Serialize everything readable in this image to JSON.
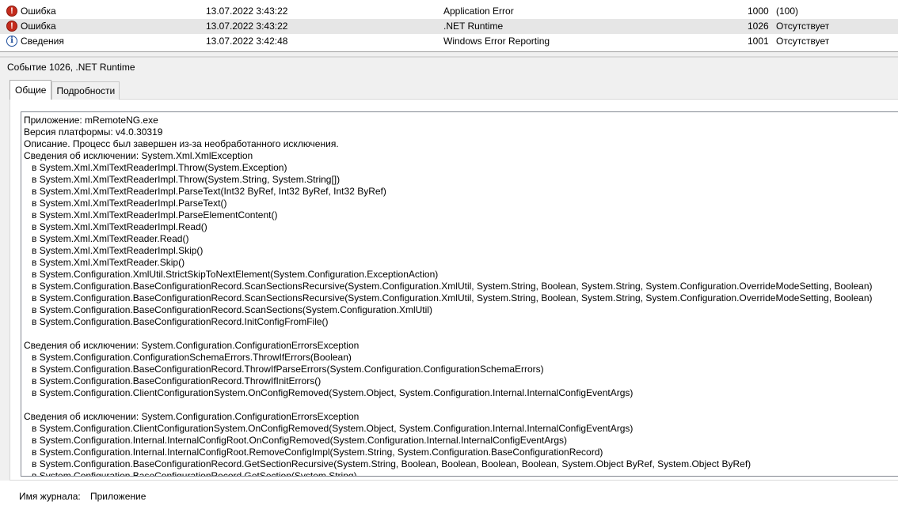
{
  "event_list": {
    "rows": [
      {
        "level": "Ошибка",
        "level_icon": "error-icon",
        "date": "13.07.2022 3:43:22",
        "source": "Application Error",
        "event_id": "1000",
        "category": "(100)",
        "selected": false
      },
      {
        "level": "Ошибка",
        "level_icon": "error-icon",
        "date": "13.07.2022 3:43:22",
        "source": ".NET Runtime",
        "event_id": "1026",
        "category": "Отсутствует",
        "selected": true
      },
      {
        "level": "Сведения",
        "level_icon": "info-icon",
        "date": "13.07.2022 3:42:48",
        "source": "Windows Error Reporting",
        "event_id": "1001",
        "category": "Отсутствует",
        "selected": false
      }
    ]
  },
  "details": {
    "title": "Событие 1026, .NET Runtime",
    "tabs": [
      {
        "label": "Общие",
        "active": true
      },
      {
        "label": "Подробности",
        "active": false
      }
    ],
    "description_lines": [
      "Приложение: mRemoteNG.exe",
      "Версия платформы: v4.0.30319",
      "Описание. Процесс был завершен из-за необработанного исключения.",
      "Сведения об исключении: System.Xml.XmlException",
      "   в System.Xml.XmlTextReaderImpl.Throw(System.Exception)",
      "   в System.Xml.XmlTextReaderImpl.Throw(System.String, System.String[])",
      "   в System.Xml.XmlTextReaderImpl.ParseText(Int32 ByRef, Int32 ByRef, Int32 ByRef)",
      "   в System.Xml.XmlTextReaderImpl.ParseText()",
      "   в System.Xml.XmlTextReaderImpl.ParseElementContent()",
      "   в System.Xml.XmlTextReaderImpl.Read()",
      "   в System.Xml.XmlTextReader.Read()",
      "   в System.Xml.XmlTextReaderImpl.Skip()",
      "   в System.Xml.XmlTextReader.Skip()",
      "   в System.Configuration.XmlUtil.StrictSkipToNextElement(System.Configuration.ExceptionAction)",
      "   в System.Configuration.BaseConfigurationRecord.ScanSectionsRecursive(System.Configuration.XmlUtil, System.String, Boolean, System.String, System.Configuration.OverrideModeSetting, Boolean)",
      "   в System.Configuration.BaseConfigurationRecord.ScanSectionsRecursive(System.Configuration.XmlUtil, System.String, Boolean, System.String, System.Configuration.OverrideModeSetting, Boolean)",
      "   в System.Configuration.BaseConfigurationRecord.ScanSections(System.Configuration.XmlUtil)",
      "   в System.Configuration.BaseConfigurationRecord.InitConfigFromFile()",
      "",
      "Сведения об исключении: System.Configuration.ConfigurationErrorsException",
      "   в System.Configuration.ConfigurationSchemaErrors.ThrowIfErrors(Boolean)",
      "   в System.Configuration.BaseConfigurationRecord.ThrowIfParseErrors(System.Configuration.ConfigurationSchemaErrors)",
      "   в System.Configuration.BaseConfigurationRecord.ThrowIfInitErrors()",
      "   в System.Configuration.ClientConfigurationSystem.OnConfigRemoved(System.Object, System.Configuration.Internal.InternalConfigEventArgs)",
      "",
      "Сведения об исключении: System.Configuration.ConfigurationErrorsException",
      "   в System.Configuration.ClientConfigurationSystem.OnConfigRemoved(System.Object, System.Configuration.Internal.InternalConfigEventArgs)",
      "   в System.Configuration.Internal.InternalConfigRoot.OnConfigRemoved(System.Configuration.Internal.InternalConfigEventArgs)",
      "   в System.Configuration.Internal.InternalConfigRoot.RemoveConfigImpl(System.String, System.Configuration.BaseConfigurationRecord)",
      "   в System.Configuration.BaseConfigurationRecord.GetSectionRecursive(System.String, Boolean, Boolean, Boolean, Boolean, System.Object ByRef, System.Object ByRef)",
      "   в System.Configuration.BaseConfigurationRecord.GetSection(System.String)"
    ],
    "log_name_label": "Имя журнала:",
    "log_name_value": "Приложение"
  }
}
